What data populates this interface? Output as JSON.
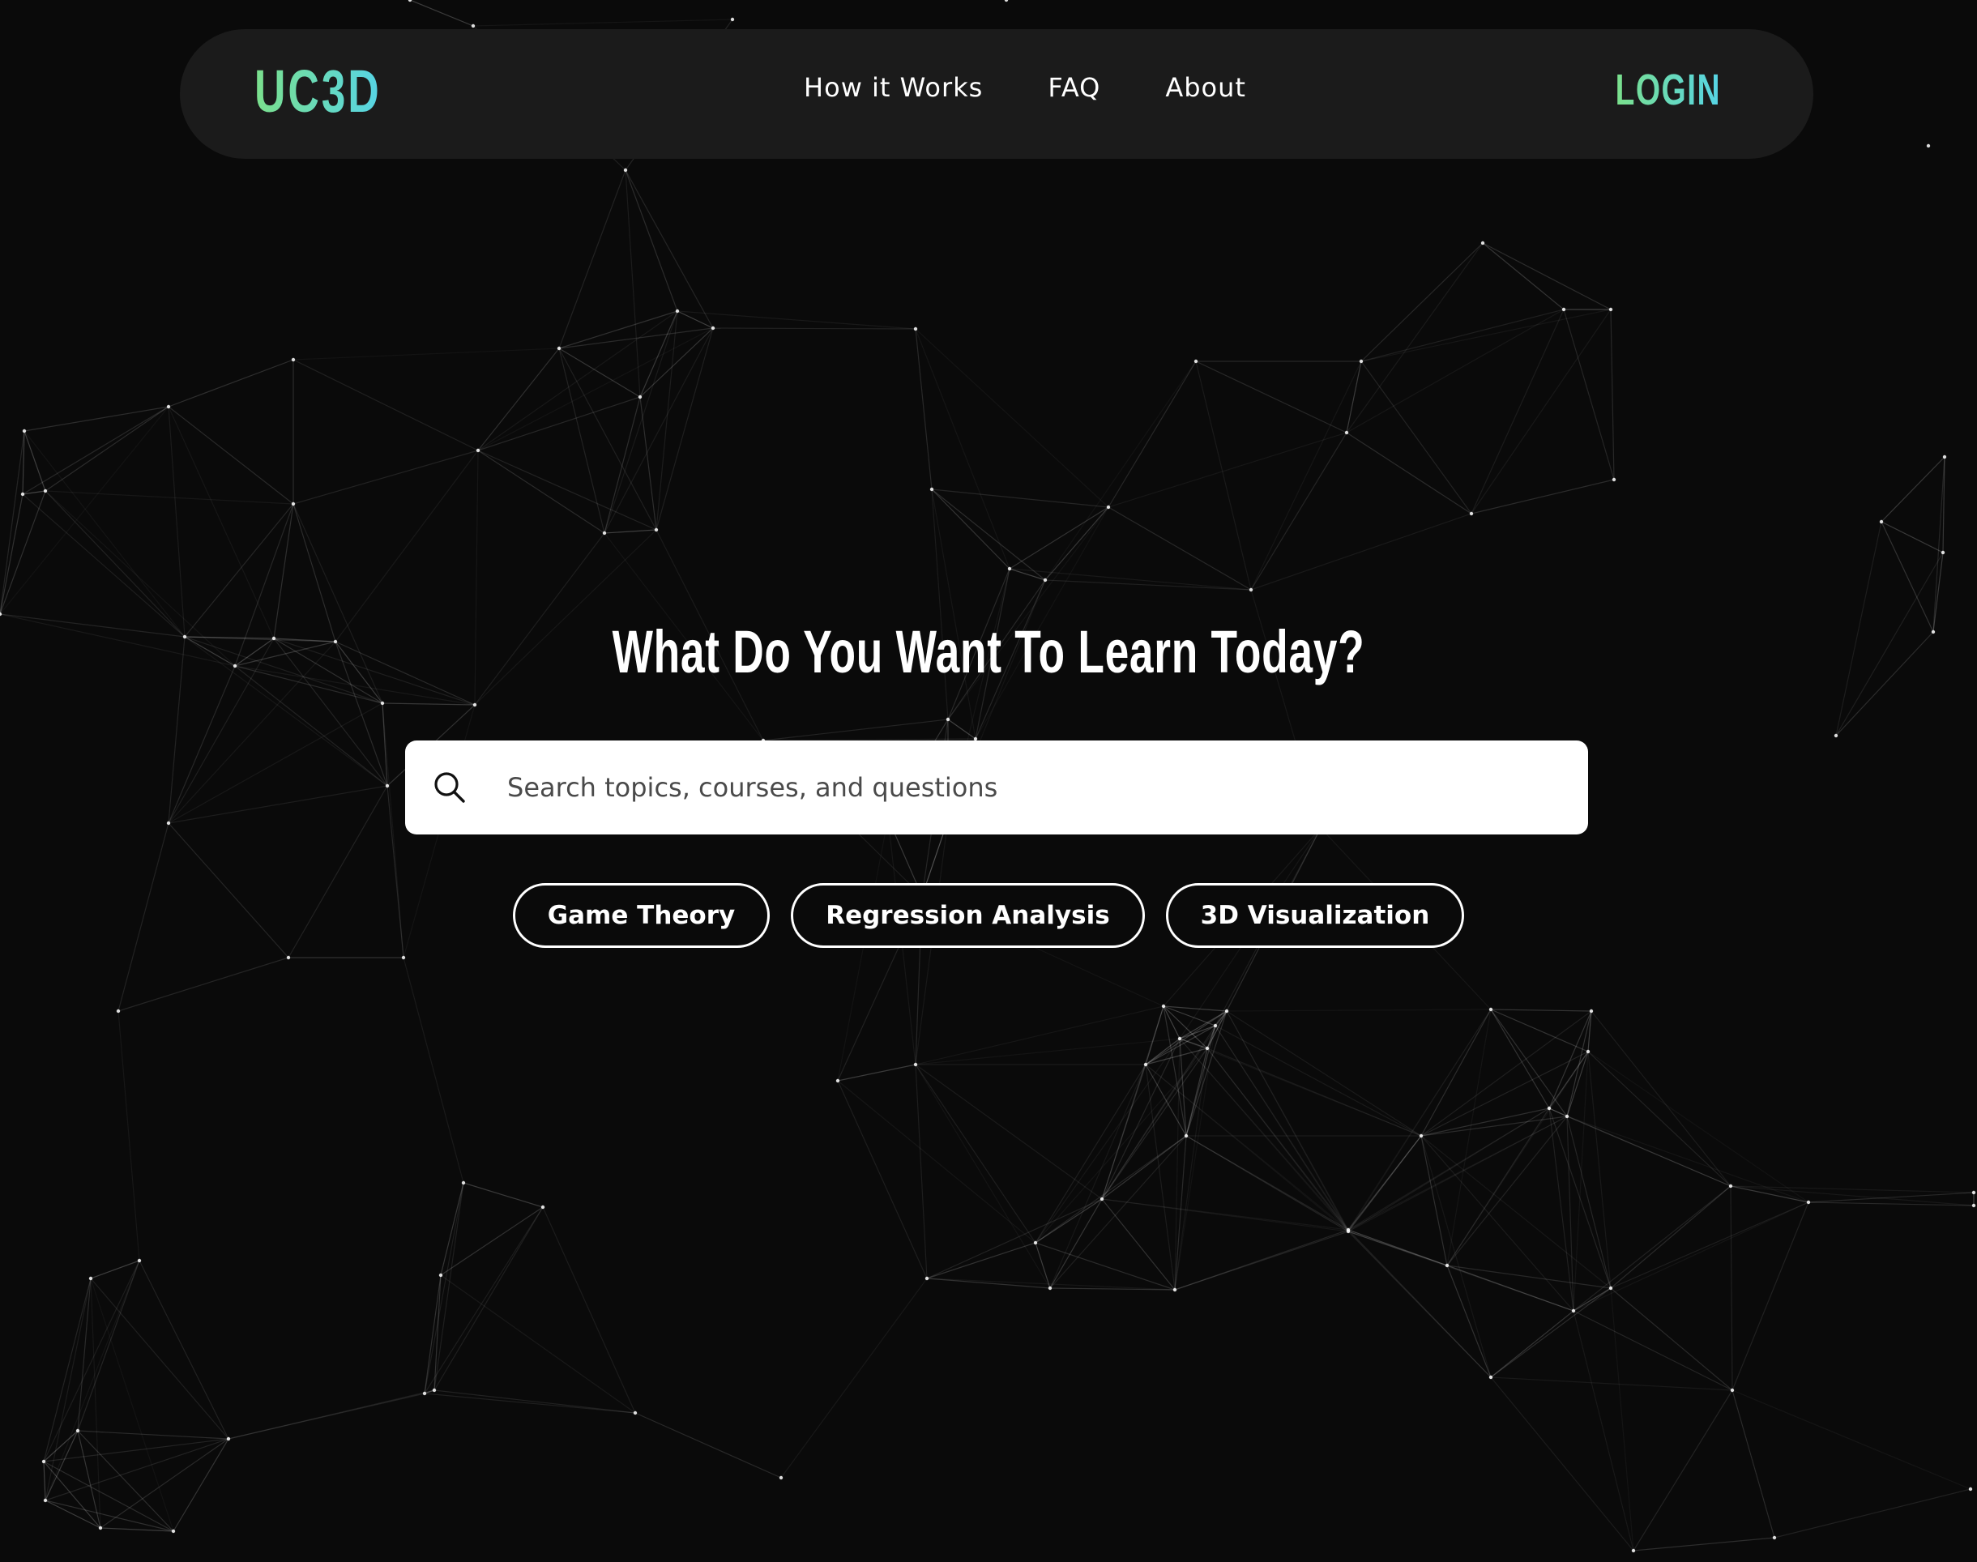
{
  "header": {
    "logo_text": "UC3D",
    "nav_links": [
      "How it Works",
      "FAQ",
      "About"
    ],
    "login_label": "LOGIN"
  },
  "hero": {
    "title": "What Do You Want To Learn Today?"
  },
  "search": {
    "placeholder": "Search topics, courses, and questions",
    "icon": "search-icon"
  },
  "chips": [
    "Game Theory",
    "Regression Analysis",
    "3D Visualization"
  ],
  "colors": {
    "background": "#0a0a0a",
    "navbar": "#1b1b1b",
    "brand_gradient_start": "#7be08c",
    "brand_gradient_end": "#56d4e6",
    "text": "#ffffff"
  }
}
